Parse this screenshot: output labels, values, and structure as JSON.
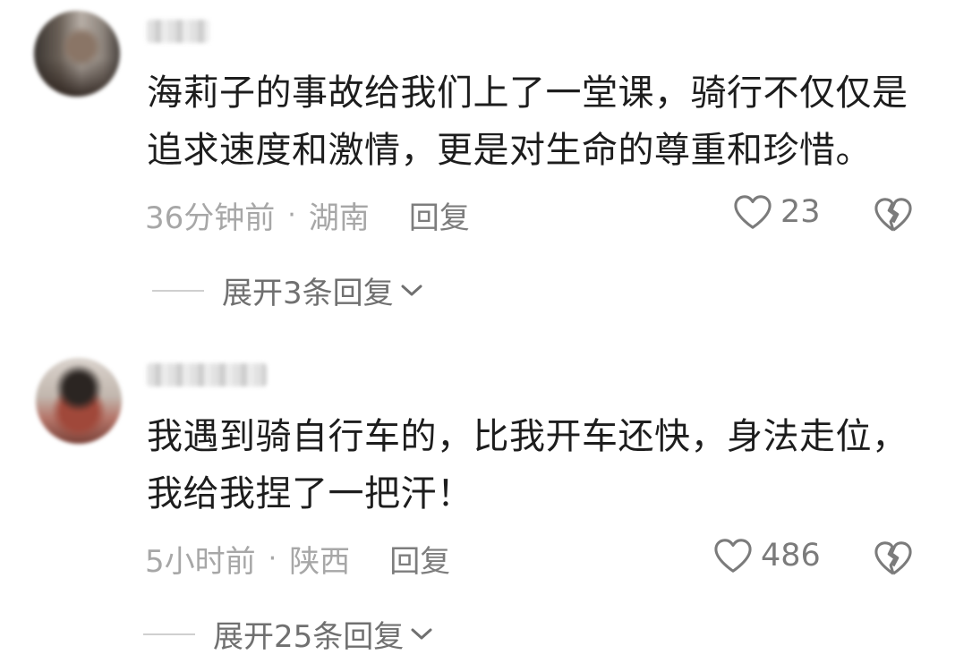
{
  "comments": [
    {
      "username": "",
      "text": "海莉子的事故给我们上了一堂课，骑行不仅仅是追求速度和激情，更是对生命的尊重和珍惜。",
      "time": "36分钟前",
      "separator": "·",
      "location": "湖南",
      "reply_label": "回复",
      "likes": "23",
      "expand_label": "展开3条回复"
    },
    {
      "username": "",
      "text": "我遇到骑自行车的，比我开车还快，身法走位，我给我捏了一把汗！",
      "time": "5小时前",
      "separator": "·",
      "location": "陕西",
      "reply_label": "回复",
      "likes": "486",
      "expand_label": "展开25条回复"
    }
  ],
  "icons": {
    "like": "heart-outline-icon",
    "dislike": "broken-heart-icon",
    "expand": "chevron-down-icon"
  },
  "colors": {
    "text": "#1d1d1d",
    "meta": "#a7a7a7",
    "action": "#7b7b7b"
  }
}
